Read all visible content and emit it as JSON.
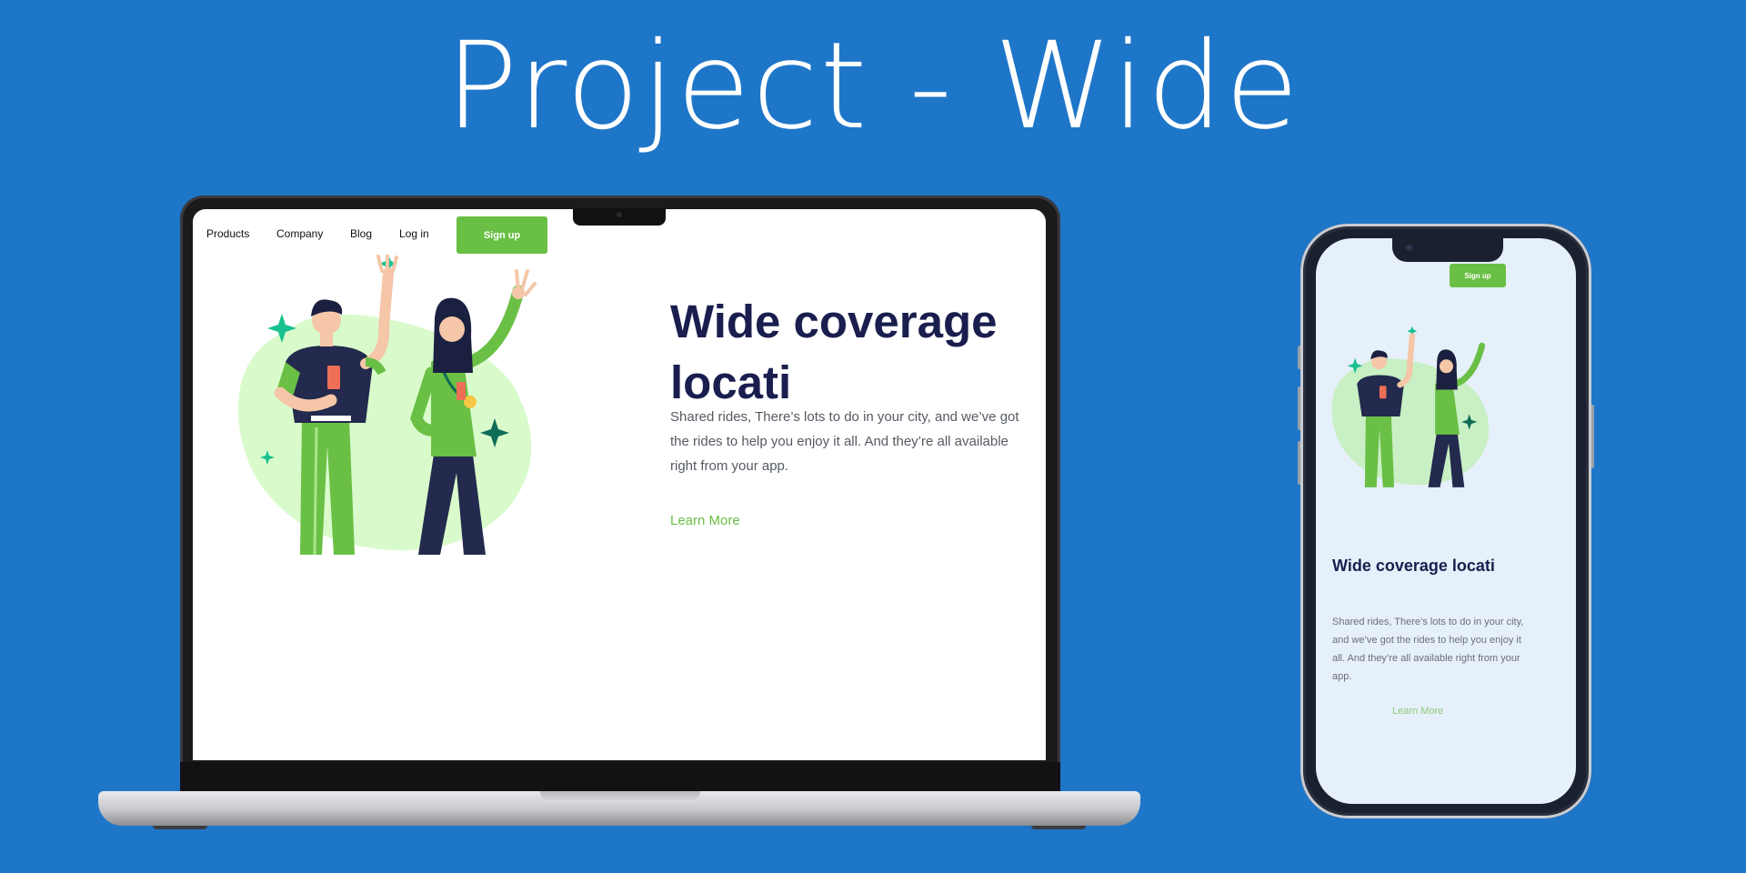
{
  "page": {
    "title": "Project - Wide",
    "background": "#1e76c9"
  },
  "site": {
    "nav": {
      "products": "Products",
      "company": "Company",
      "blog": "Blog",
      "login": "Log in",
      "signup": "Sign up"
    },
    "hero": {
      "heading": "Wide coverage locati",
      "body": "Shared rides, There’s lots to do in your city, and we’ve got the rides to help you enjoy it all. And they’re all available right from your app.",
      "cta": "Learn More"
    },
    "colors": {
      "accent": "#6abf45",
      "heading": "#1a1e4e",
      "blob": "#d9fbcc",
      "navy": "#232a4d",
      "sparkle": "#18a97a"
    }
  },
  "mobile": {
    "signup": "Sign up",
    "heading": "Wide coverage locati",
    "body": "Shared rides, There’s lots to do in your city, and we’ve got the rides to help you enjoy it all. And they’re all available right from your app.",
    "cta": "Learn More",
    "screen_bg": "#e6f0fa"
  }
}
